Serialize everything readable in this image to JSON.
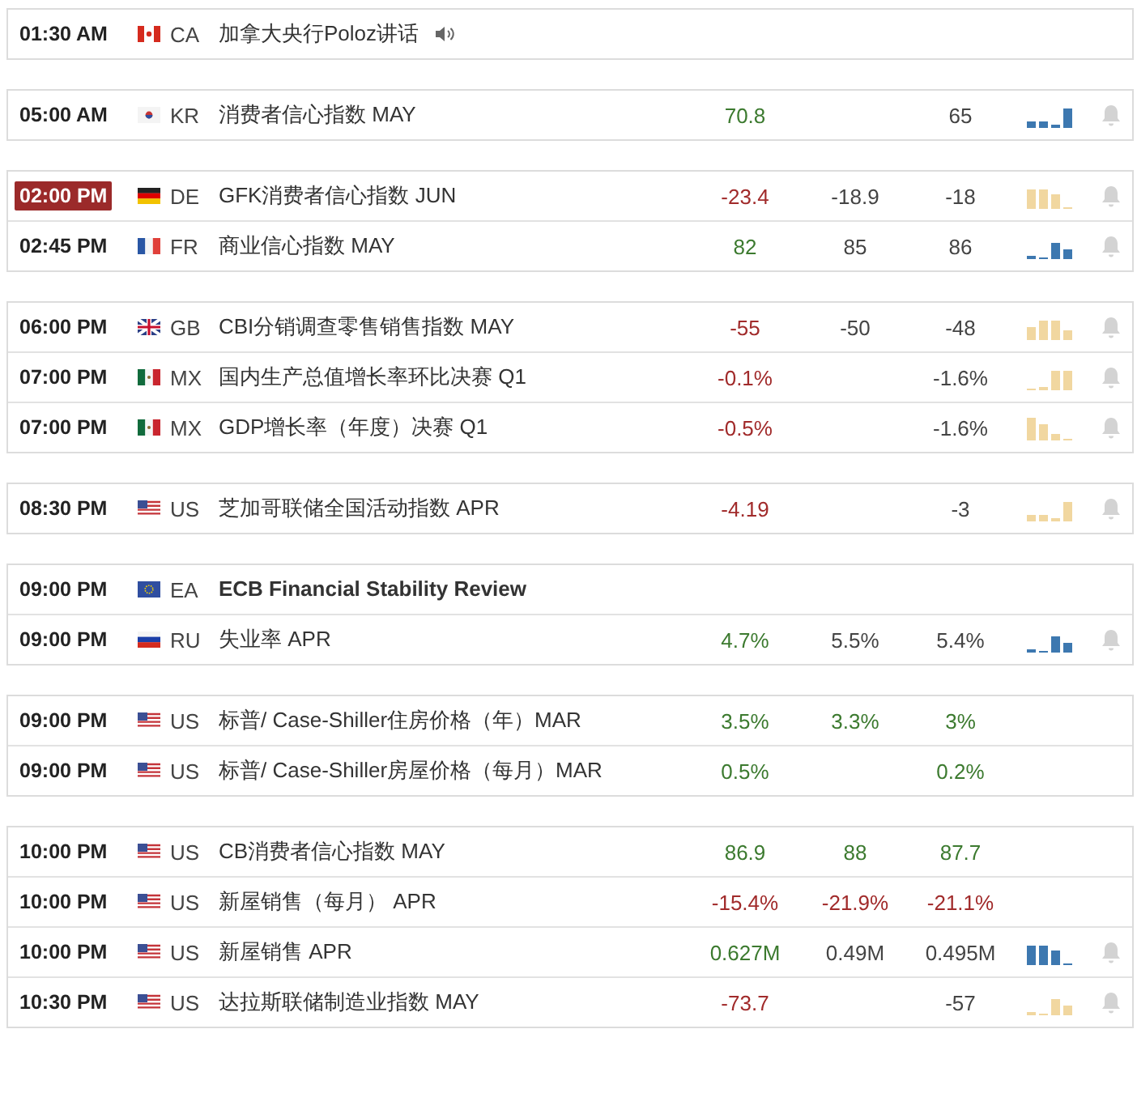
{
  "groups": [
    {
      "rows": [
        {
          "time": "01:30 AM",
          "highlighted": false,
          "flag": {
            "kind": "ca"
          },
          "country": "CA",
          "event": "加拿大央行Poloz讲话",
          "speech": true,
          "bold": false,
          "alert": false
        }
      ]
    },
    {
      "rows": [
        {
          "time": "05:00 AM",
          "highlighted": false,
          "flag": {
            "kind": "kr"
          },
          "country": "KR",
          "event": "消费者信心指数 MAY",
          "speech": false,
          "bold": false,
          "actual": {
            "text": "70.8",
            "color": "#3c7a2f"
          },
          "previous": {
            "text": "65",
            "color": "#444444"
          },
          "sparkline": {
            "color": "#3d78b0"
          },
          "alert": true
        }
      ]
    },
    {
      "rows": [
        {
          "time": "02:00 PM",
          "highlighted": true,
          "flag": {
            "kind": "de"
          },
          "country": "DE",
          "event": "GFK消费者信心指数 JUN",
          "speech": false,
          "bold": false,
          "actual": {
            "text": "-23.4",
            "color": "#a12b2b"
          },
          "forecast": {
            "text": "-18.9",
            "color": "#444444"
          },
          "previous": {
            "text": "-18",
            "color": "#444444"
          },
          "sparkline": {
            "color": "#f1d7a0"
          },
          "alert": true
        },
        {
          "time": "02:45 PM",
          "highlighted": false,
          "flag": {
            "kind": "fr"
          },
          "country": "FR",
          "event": "商业信心指数 MAY",
          "speech": false,
          "bold": false,
          "actual": {
            "text": "82",
            "color": "#3c7a2f"
          },
          "forecast": {
            "text": "85",
            "color": "#444444"
          },
          "previous": {
            "text": "86",
            "color": "#444444"
          },
          "sparkline": {
            "color": "#3d78b0"
          },
          "alert": true
        }
      ]
    },
    {
      "rows": [
        {
          "time": "06:00 PM",
          "highlighted": false,
          "flag": {
            "kind": "gb"
          },
          "country": "GB",
          "event": "CBI分销调查零售销售指数 MAY",
          "speech": false,
          "bold": false,
          "actual": {
            "text": "-55",
            "color": "#a12b2b"
          },
          "forecast": {
            "text": "-50",
            "color": "#444444"
          },
          "previous": {
            "text": "-48",
            "color": "#444444"
          },
          "sparkline": {
            "color": "#f1d7a0"
          },
          "alert": true
        },
        {
          "time": "07:00 PM",
          "highlighted": false,
          "flag": {
            "kind": "mx"
          },
          "country": "MX",
          "event": "国内生产总值增长率环比决赛 Q1",
          "speech": false,
          "bold": false,
          "actual": {
            "text": "-0.1%",
            "color": "#a12b2b"
          },
          "previous": {
            "text": "-1.6%",
            "color": "#444444"
          },
          "sparkline": {
            "color": "#f1d7a0"
          },
          "alert": true
        },
        {
          "time": "07:00 PM",
          "highlighted": false,
          "flag": {
            "kind": "mx"
          },
          "country": "MX",
          "event": "GDP增长率（年度）决赛 Q1",
          "speech": false,
          "bold": false,
          "actual": {
            "text": "-0.5%",
            "color": "#a12b2b"
          },
          "previous": {
            "text": "-1.6%",
            "color": "#444444"
          },
          "sparkline": {
            "color": "#f1d7a0"
          },
          "alert": true
        }
      ]
    },
    {
      "rows": [
        {
          "time": "08:30 PM",
          "highlighted": false,
          "flag": {
            "kind": "us"
          },
          "country": "US",
          "event": "芝加哥联储全国活动指数 APR",
          "speech": false,
          "bold": false,
          "actual": {
            "text": "-4.19",
            "color": "#a12b2b"
          },
          "previous": {
            "text": "-3",
            "color": "#444444"
          },
          "sparkline": {
            "color": "#f1d7a0"
          },
          "alert": true
        }
      ]
    },
    {
      "rows": [
        {
          "time": "09:00 PM",
          "highlighted": false,
          "flag": {
            "kind": "eu"
          },
          "country": "EA",
          "event": "ECB Financial Stability Review",
          "speech": false,
          "bold": true,
          "alert": false
        },
        {
          "time": "09:00 PM",
          "highlighted": false,
          "flag": {
            "kind": "ru"
          },
          "country": "RU",
          "event": "失业率 APR",
          "speech": false,
          "bold": false,
          "actual": {
            "text": "4.7%",
            "color": "#3c7a2f"
          },
          "forecast": {
            "text": "5.5%",
            "color": "#444444"
          },
          "previous": {
            "text": "5.4%",
            "color": "#444444"
          },
          "sparkline": {
            "color": "#3d78b0"
          },
          "alert": true
        }
      ]
    },
    {
      "rows": [
        {
          "time": "09:00 PM",
          "highlighted": false,
          "flag": {
            "kind": "us"
          },
          "country": "US",
          "event": "标普/ Case-Shiller住房价格（年）MAR",
          "speech": false,
          "bold": false,
          "actual": {
            "text": "3.5%",
            "color": "#3c7a2f"
          },
          "forecast": {
            "text": "3.3%",
            "color": "#3c7a2f"
          },
          "previous": {
            "text": "3%",
            "color": "#3c7a2f"
          },
          "alert": false
        },
        {
          "time": "09:00 PM",
          "highlighted": false,
          "flag": {
            "kind": "us"
          },
          "country": "US",
          "event": "标普/ Case-Shiller房屋价格（每月）MAR",
          "speech": false,
          "bold": false,
          "actual": {
            "text": "0.5%",
            "color": "#3c7a2f"
          },
          "previous": {
            "text": "0.2%",
            "color": "#3c7a2f"
          },
          "alert": false
        }
      ]
    },
    {
      "rows": [
        {
          "time": "10:00 PM",
          "highlighted": false,
          "flag": {
            "kind": "us"
          },
          "country": "US",
          "event": "CB消费者信心指数 MAY",
          "speech": false,
          "bold": false,
          "actual": {
            "text": "86.9",
            "color": "#3c7a2f"
          },
          "forecast": {
            "text": "88",
            "color": "#3c7a2f"
          },
          "previous": {
            "text": "87.7",
            "color": "#3c7a2f"
          },
          "alert": false
        },
        {
          "time": "10:00 PM",
          "highlighted": false,
          "flag": {
            "kind": "us"
          },
          "country": "US",
          "event": "新屋销售（每月） APR",
          "speech": false,
          "bold": false,
          "actual": {
            "text": "-15.4%",
            "color": "#a12b2b"
          },
          "forecast": {
            "text": "-21.9%",
            "color": "#a12b2b"
          },
          "previous": {
            "text": "-21.1%",
            "color": "#a12b2b"
          },
          "alert": false
        },
        {
          "time": "10:00 PM",
          "highlighted": false,
          "flag": {
            "kind": "us"
          },
          "country": "US",
          "event": "新屋销售 APR",
          "speech": false,
          "bold": false,
          "actual": {
            "text": "0.627M",
            "color": "#3c7a2f"
          },
          "forecast": {
            "text": "0.49M",
            "color": "#444444"
          },
          "previous": {
            "text": "0.495M",
            "color": "#444444"
          },
          "sparkline": {
            "color": "#3d78b0"
          },
          "alert": true
        },
        {
          "time": "10:30 PM",
          "highlighted": false,
          "flag": {
            "kind": "us"
          },
          "country": "US",
          "event": "达拉斯联储制造业指数 MAY",
          "speech": false,
          "bold": false,
          "actual": {
            "text": "-73.7",
            "color": "#a12b2b"
          },
          "previous": {
            "text": "-57",
            "color": "#444444"
          },
          "sparkline": {
            "color": "#f1d7a0"
          },
          "alert": true
        }
      ]
    }
  ]
}
